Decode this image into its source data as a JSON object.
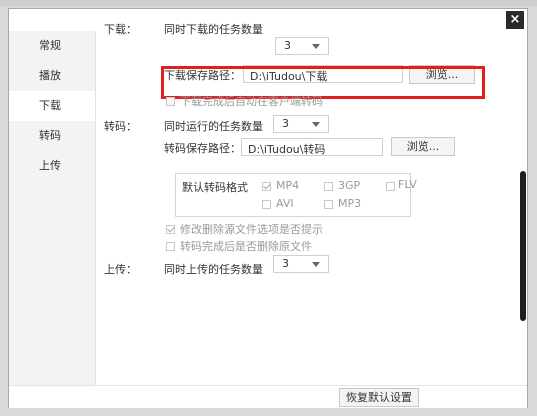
{
  "window": {
    "close_glyph": "×"
  },
  "sidebar": {
    "items": [
      {
        "label": "常规"
      },
      {
        "label": "播放"
      },
      {
        "label": "下载"
      },
      {
        "label": "转码"
      },
      {
        "label": "上传"
      }
    ],
    "active": "下载"
  },
  "download": {
    "section_label": "下载：",
    "concurrent_label": "同时下载的任务数量",
    "concurrent_value": "3",
    "path_label": "下载保存路径：",
    "path_value": "D:\\iTudou\\下载",
    "browse_label": "浏览...",
    "auto_transcode_label": "下载完成后自动在客户端转码",
    "auto_transcode_checked": false
  },
  "transcode": {
    "section_label": "转码：",
    "concurrent_label": "同时运行的任务数量",
    "concurrent_value": "3",
    "path_label": "转码保存路径：",
    "path_value": "D:\\iTudou\\转码",
    "browse_label": "浏览...",
    "format_label": "默认转码格式",
    "formats": [
      {
        "label": "MP4",
        "checked": true
      },
      {
        "label": "3GP",
        "checked": false
      },
      {
        "label": "FLV",
        "checked": false
      },
      {
        "label": "AVI",
        "checked": false
      },
      {
        "label": "MP3",
        "checked": false
      }
    ],
    "prompt_delete_label": "修改删除源文件选项是否提示",
    "prompt_delete_checked": true,
    "delete_after_label": "转码完成后是否删除原文件",
    "delete_after_checked": false
  },
  "upload": {
    "section_label": "上传：",
    "concurrent_label": "同时上传的任务数量",
    "concurrent_value": "3"
  },
  "footer": {
    "reset_label": "恢复默认设置"
  },
  "colors": {
    "highlight": "#e02020",
    "scrollbar": "#1e1e1e"
  }
}
